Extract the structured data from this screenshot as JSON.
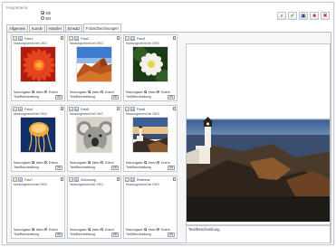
{
  "header": {
    "label": "Hauptmenü",
    "options": [
      {
        "label": "DE",
        "selected": true
      },
      {
        "label": "EN",
        "selected": false
      }
    ]
  },
  "toolbar": {
    "icons": [
      "search-icon",
      "ok-icon",
      "save-icon",
      "stop-icon",
      "delete-icon"
    ]
  },
  "tabs": [
    {
      "label": "Allgemein",
      "active": false
    },
    {
      "label": "Kunde",
      "active": false
    },
    {
      "label": "Händler",
      "active": false
    },
    {
      "label": "Einsatz",
      "active": false
    },
    {
      "label": "Fotos/Zeichnungen",
      "active": true
    }
  ],
  "cards": [
    {
      "title": "Foto1",
      "usage": "Nutzungsrecht bei OKG",
      "has_image": true,
      "image": "flower-red"
    },
    {
      "title": "Foto2",
      "usage": "Nutzungsrecht bei OKG",
      "has_image": true,
      "image": "desert"
    },
    {
      "title": "Foto3",
      "usage": "Nutzungsrecht bei OKG",
      "has_image": true,
      "image": "flower-white"
    },
    {
      "title": "Foto4",
      "usage": "Nutzungsrecht bei OKG",
      "has_image": true,
      "image": "jellyfish"
    },
    {
      "title": "Foto5",
      "usage": "Nutzungsrecht bei OKG",
      "has_image": true,
      "image": "koala"
    },
    {
      "title": "Foto6",
      "usage": "Nutzungsrecht bei OKG",
      "has_image": true,
      "image": "lighthouse"
    },
    {
      "title": "Foto7",
      "usage": "Nutzungsrecht bei OKG",
      "has_image": false,
      "image": ""
    },
    {
      "title": "Zeichnung",
      "usage": "Nutzungsrecht bei OKG",
      "has_image": false,
      "image": ""
    },
    {
      "title": "Referenz",
      "usage": "Nutzungsrecht bei OKG",
      "has_image": false,
      "image": ""
    }
  ],
  "card_labels": {
    "usage_type": "Nutzungsart:",
    "intern": "Intern",
    "extern": "Extern",
    "description": "Text/Beschreibung",
    "ok": "OK"
  },
  "preview": {
    "description_label": "Text/Beschreibung"
  }
}
